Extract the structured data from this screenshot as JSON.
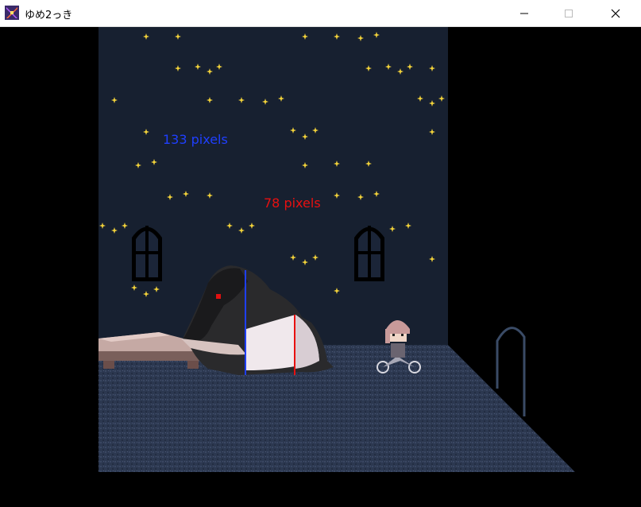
{
  "window": {
    "title": "ゆめ2っき",
    "icon": "yume2kki-app-icon",
    "controls": [
      "minimize-icon",
      "maximize-icon",
      "close-icon"
    ]
  },
  "annotations": [
    {
      "text": "133 pixels",
      "color": "#1f3fff"
    },
    {
      "text": "78 pixels",
      "color": "#e81010"
    }
  ],
  "colors": {
    "sky": "#172030",
    "floor": "#2c3850",
    "star": "#f2d23a",
    "window_frame": "#000000",
    "bed": "#c5a9a4"
  },
  "scene": {
    "creature": "giant-tapir-creature",
    "player": "madotsuki-on-bicycle",
    "props": [
      "bed",
      "arched-window-left",
      "arched-window-right",
      "arched-doorway"
    ]
  }
}
